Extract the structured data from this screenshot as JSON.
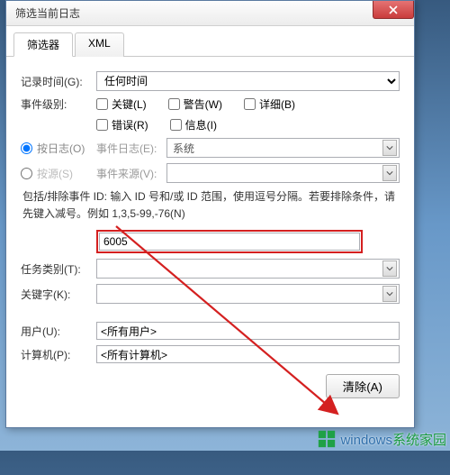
{
  "window": {
    "title": "筛选当前日志"
  },
  "tabs": {
    "filter": "筛选器",
    "xml": "XML"
  },
  "form": {
    "logged_label": "记录时间(G):",
    "logged_value": "任何时间",
    "level_label": "事件级别:",
    "level_critical": "关键(L)",
    "level_warning": "警告(W)",
    "level_verbose": "详细(B)",
    "level_error": "错误(R)",
    "level_info": "信息(I)",
    "by_log_label": "按日志(O)",
    "event_log_label": "事件日志(E):",
    "event_log_value": "系统",
    "by_source_label": "按源(S)",
    "event_source_label": "事件来源(V):",
    "event_source_value": "",
    "id_help": "包括/排除事件 ID: 输入 ID 号和/或 ID 范围，使用逗号分隔。若要排除条件，请先键入减号。例如 1,3,5-99,-76(N)",
    "id_value": "6005",
    "task_label": "任务类别(T):",
    "keyword_label": "关键字(K):",
    "user_label": "用户(U):",
    "user_value": "<所有用户>",
    "computer_label": "计算机(P):",
    "computer_value": "<所有计算机>",
    "clear_btn": "清除(A)"
  },
  "watermark": {
    "brand": "windows",
    "suffix": "系统家园"
  }
}
